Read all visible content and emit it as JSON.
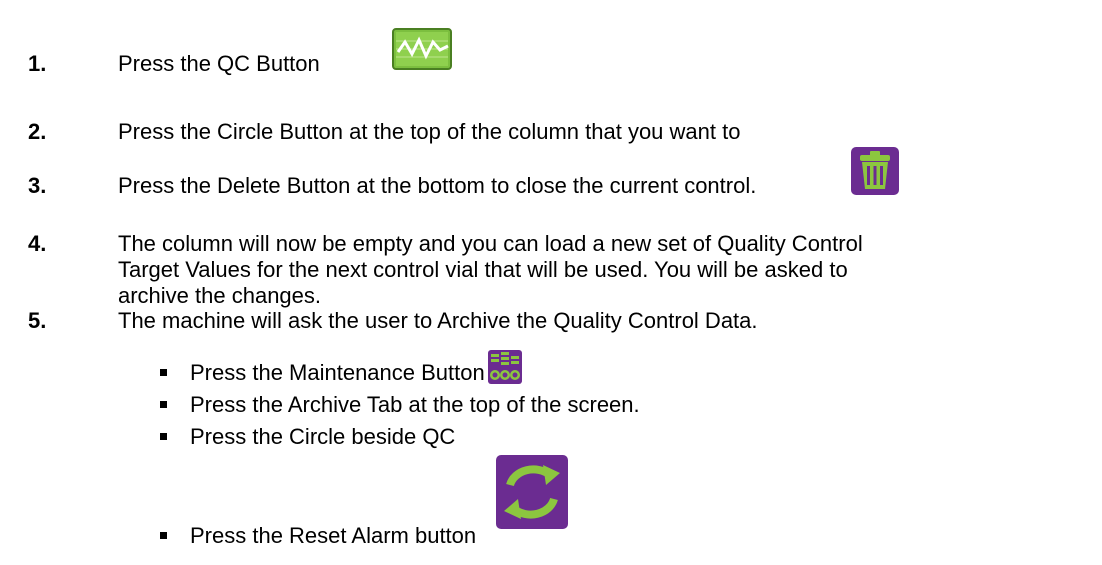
{
  "steps": [
    {
      "num": "1.",
      "text": "Press the QC Button",
      "icon": "qc-chart-icon"
    },
    {
      "num": "2.",
      "text": "Press the Circle Button at the top of the column that you want to"
    },
    {
      "num": "3.",
      "text": "Press the Delete Button at the bottom to close the current control.",
      "icon": "trash-icon"
    },
    {
      "num": "4.",
      "lines": [
        "The column will now be empty and you can load a new set of Quality Control",
        "Target Values for the next control vial that will be used. You will be asked to",
        "archive the changes."
      ]
    },
    {
      "num": "5.",
      "text": "The machine will ask the user to Archive the Quality Control Data."
    }
  ],
  "substeps": [
    {
      "text": "Press the Maintenance Button",
      "icon": "maintenance-icon"
    },
    {
      "text": "Press the Archive Tab at the top of the screen."
    },
    {
      "text": "Press the Circle beside QC"
    },
    {
      "text": "Press the Reset Alarm button",
      "icon": "reset-alarm-icon"
    }
  ],
  "colors": {
    "qc_icon_bg": "#6fb23a",
    "purple_icon_bg": "#6b2c91",
    "icon_green": "#8cc63f",
    "text": "#000000"
  }
}
